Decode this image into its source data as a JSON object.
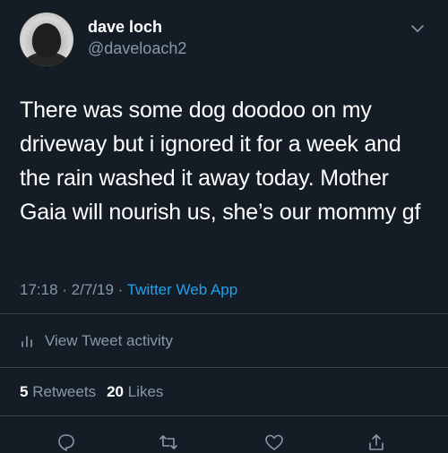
{
  "author": {
    "display_name": "dave loch",
    "handle": "@daveloach2"
  },
  "tweet": {
    "text_lines": [
      "There was some dog doodoo on my",
      "driveway but i ignored it for a week and",
      "the rain washed it away today. Mother",
      "Gaia will nourish us, she’s our mommy gf"
    ]
  },
  "meta": {
    "time": "17:18",
    "separator": " · ",
    "date": "2/7/19",
    "source": "Twitter Web App"
  },
  "activity": {
    "label": "View Tweet activity",
    "icon": "bar-chart-icon"
  },
  "stats": {
    "retweets_count": "5",
    "retweets_label": "Retweets",
    "likes_count": "20",
    "likes_label": "Likes"
  },
  "actions": [
    {
      "name": "reply",
      "icon": "reply-icon"
    },
    {
      "name": "retweet",
      "icon": "retweet-icon"
    },
    {
      "name": "like",
      "icon": "heart-icon"
    },
    {
      "name": "share",
      "icon": "share-icon"
    }
  ],
  "colors": {
    "background": "#141d26",
    "text_primary": "#ffffff",
    "text_secondary": "#8899a6",
    "link": "#1da1f2",
    "divider": "#38444d"
  }
}
